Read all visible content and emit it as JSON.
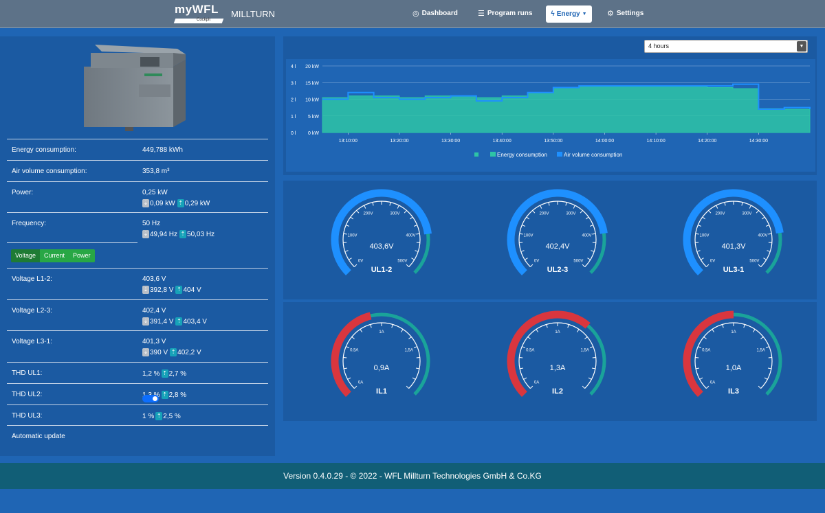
{
  "navbar": {
    "logo_text": "myWFL",
    "logo_sub": "Cockpit",
    "brand": "MILLTURN",
    "items": [
      {
        "label": "Dashboard",
        "icon": "dashboard-icon"
      },
      {
        "label": "Program runs",
        "icon": "list-icon"
      },
      {
        "label": "Energy",
        "icon": "bolt-icon",
        "active": true
      },
      {
        "label": "Settings",
        "icon": "gear-icon"
      }
    ]
  },
  "left": {
    "energy": {
      "label": "Energy consumption:",
      "value": "449,788 kWh"
    },
    "air": {
      "label": "Air volume consumption:",
      "value": "353,8 m³"
    },
    "power": {
      "label": "Power:",
      "value": "0,25 kW",
      "min": "0,09 kW",
      "max": "0,29 kW"
    },
    "frequency": {
      "label": "Frequency:",
      "value": "50 Hz",
      "min": "49,94 Hz",
      "max": "50,03 Hz"
    },
    "buttons": [
      "Voltage",
      "Current",
      "Power"
    ],
    "voltage_l12": {
      "label": "Voltage L1-2:",
      "value": "403,6 V",
      "min": "392,8 V",
      "max": "404 V"
    },
    "voltage_l23": {
      "label": "Voltage L2-3:",
      "value": "402,4 V",
      "min": "391,4 V",
      "max": "403,4 V"
    },
    "voltage_l31": {
      "label": "Voltage L3-1:",
      "value": "401,3 V",
      "min": "390 V",
      "max": "402,2 V"
    },
    "thd_ul1": {
      "label": "THD UL1:",
      "value": "1,2 %",
      "max": "2,7 %"
    },
    "thd_ul2": {
      "label": "THD UL2:",
      "value": "1,3 %",
      "max": "2,8 %"
    },
    "thd_ul3": {
      "label": "THD UL3:",
      "value": "1 %",
      "max": "2,5 %"
    },
    "auto_update": {
      "label": "Automatic update",
      "on": true
    }
  },
  "range_select": "4 hours",
  "chart_data": {
    "type": "area",
    "x": [
      "13:05:00",
      "13:10:00",
      "13:15:00",
      "13:20:00",
      "13:25:00",
      "13:30:00",
      "13:35:00",
      "13:40:00",
      "13:45:00",
      "13:50:00",
      "13:55:00",
      "14:00:00",
      "14:05:00",
      "14:10:00",
      "14:15:00",
      "14:20:00",
      "14:25:00",
      "14:30:00",
      "14:35:00",
      "14:37:00"
    ],
    "x_ticks": [
      "13:10:00",
      "13:20:00",
      "13:30:00",
      "13:40:00",
      "13:50:00",
      "14:00:00",
      "14:10:00",
      "14:20:00",
      "14:30:00"
    ],
    "series": [
      {
        "name": "Energy consumption",
        "axis": "kW",
        "color": "#2ec4a6",
        "values": [
          10.5,
          11,
          11,
          10.5,
          11,
          11,
          10.5,
          11,
          12,
          13.5,
          13.8,
          13.8,
          13.8,
          13.8,
          13.8,
          13.5,
          13.2,
          7.2,
          7,
          6.8
        ]
      },
      {
        "name": "Air volume consumption",
        "axis": "l",
        "color": "#1e90ff",
        "values": [
          2,
          2.4,
          2.1,
          2,
          2.1,
          2.2,
          1.9,
          2.1,
          2.4,
          2.7,
          2.8,
          2.8,
          2.8,
          2.8,
          2.8,
          2.8,
          2.9,
          1.4,
          1.5,
          1.4
        ]
      }
    ],
    "y_left_ticks": [
      "0 l",
      "1 l",
      "2 l",
      "3 l",
      "4 l"
    ],
    "y_right_ticks": [
      "0 kW",
      "5 kW",
      "10 kW",
      "15 kW",
      "20 kW"
    ],
    "ylim_kw": [
      0,
      20
    ],
    "ylim_l": [
      0,
      4
    ],
    "legend_placement": "bottom"
  },
  "voltage_gauges": [
    {
      "name": "UL1-2",
      "value": 403.6,
      "text": "403,6V",
      "ticks": [
        "0V",
        "100V",
        "200V",
        "300V",
        "400V",
        "500V"
      ],
      "max": 500,
      "color": "#1e90ff"
    },
    {
      "name": "UL2-3",
      "value": 402.4,
      "text": "402,4V",
      "ticks": [
        "0V",
        "100V",
        "200V",
        "300V",
        "400V",
        "500V"
      ],
      "max": 500,
      "color": "#1e90ff"
    },
    {
      "name": "UL3-1",
      "value": 401.3,
      "text": "401,3V",
      "ticks": [
        "0V",
        "100V",
        "200V",
        "300V",
        "400V",
        "500V"
      ],
      "max": 500,
      "color": "#1e90ff"
    }
  ],
  "current_gauges": [
    {
      "name": "IL1",
      "value": 0.9,
      "text": "0,9A",
      "ticks": [
        "0A",
        "0,5A",
        "1A",
        "1,5A"
      ],
      "max": 2,
      "color": "#d9363e"
    },
    {
      "name": "IL2",
      "value": 1.3,
      "text": "1,3A",
      "ticks": [
        "0A",
        "0,5A",
        "1A",
        "1,5A"
      ],
      "max": 2,
      "color": "#d9363e"
    },
    {
      "name": "IL3",
      "value": 1.0,
      "text": "1,0A",
      "ticks": [
        "0A",
        "0,5A",
        "1A",
        "1,5A"
      ],
      "max": 2,
      "color": "#d9363e"
    }
  ],
  "footer": "Version 0.4.0.29 - © 2022 - WFL Millturn Technologies GmbH & Co.KG"
}
